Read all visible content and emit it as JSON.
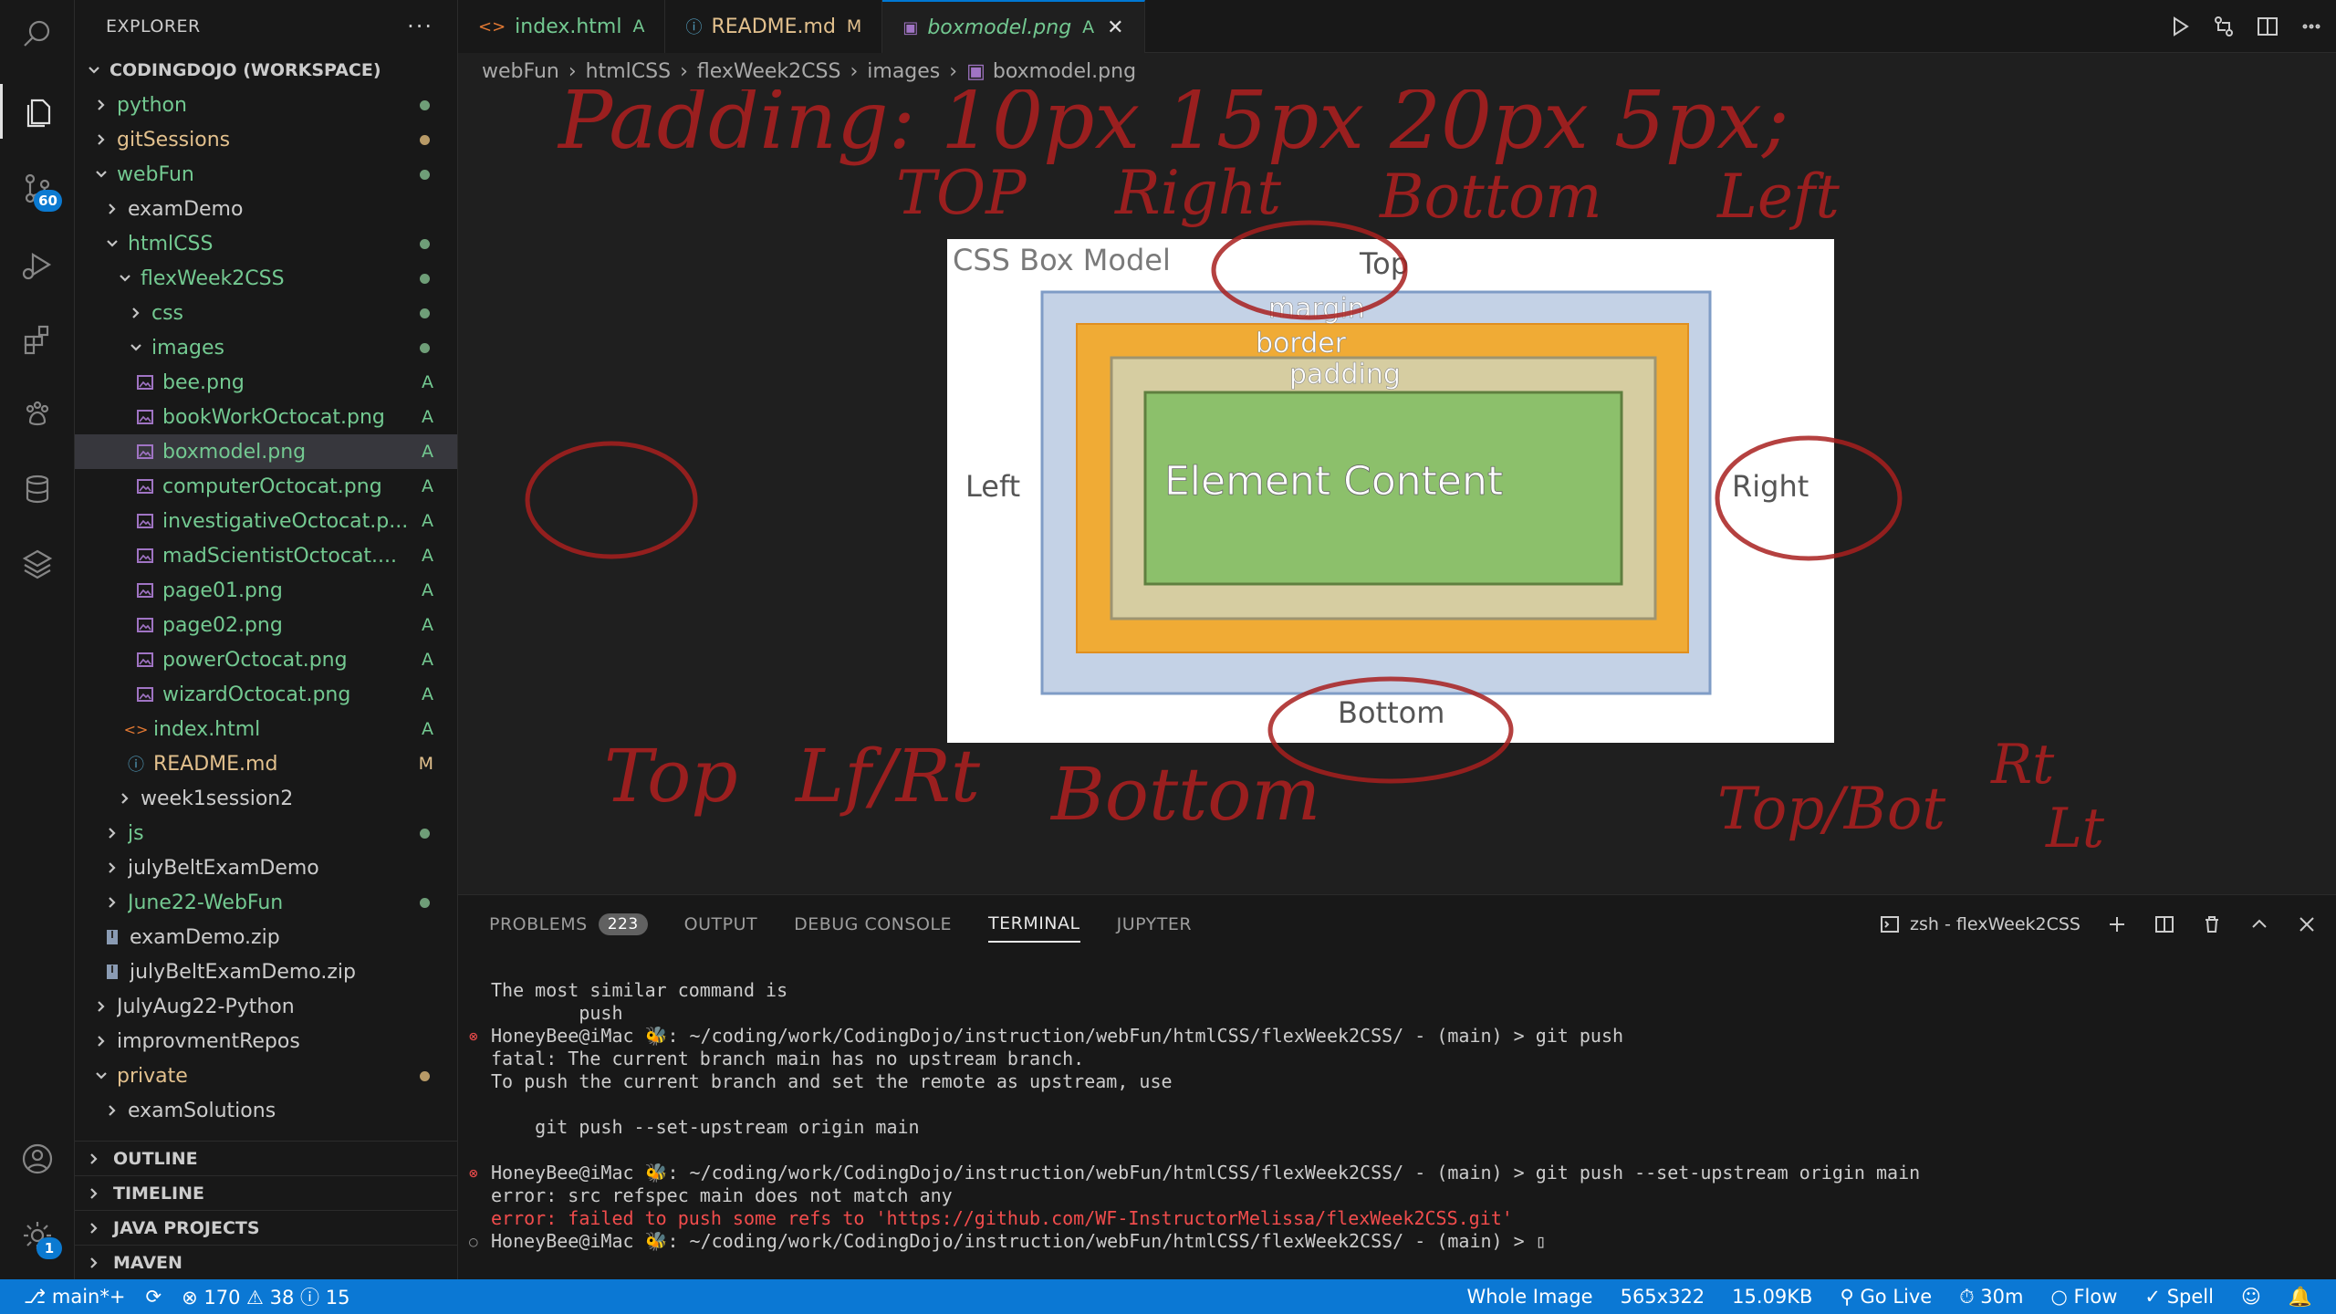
{
  "activity_bar": {
    "scm_badge": "60",
    "settings_badge": "1"
  },
  "sidebar": {
    "title": "EXPLORER",
    "more": "···",
    "workspace": "CODINGDOJO (WORKSPACE)",
    "tree": [
      {
        "label": "python",
        "deco": "",
        "color": "green"
      },
      {
        "label": "gitSessions",
        "deco": "",
        "color": "yellow"
      },
      {
        "label": "webFun",
        "deco": "",
        "color": "green"
      },
      {
        "label": "examDemo",
        "deco": "",
        "color": "plain"
      },
      {
        "label": "htmlCSS",
        "deco": "",
        "color": "green"
      },
      {
        "label": "flexWeek2CSS",
        "deco": "",
        "color": "green"
      },
      {
        "label": "css",
        "deco": "",
        "color": "green"
      },
      {
        "label": "images",
        "deco": "",
        "color": "green"
      },
      {
        "label": "bee.png",
        "deco": "A",
        "color": "green"
      },
      {
        "label": "bookWorkOctocat.png",
        "deco": "A",
        "color": "green"
      },
      {
        "label": "boxmodel.png",
        "deco": "A",
        "color": "green"
      },
      {
        "label": "computerOctocat.png",
        "deco": "A",
        "color": "green"
      },
      {
        "label": "investigativeOctocat.p...",
        "deco": "A",
        "color": "green"
      },
      {
        "label": "madScientistOctocat....",
        "deco": "A",
        "color": "green"
      },
      {
        "label": "page01.png",
        "deco": "A",
        "color": "green"
      },
      {
        "label": "page02.png",
        "deco": "A",
        "color": "green"
      },
      {
        "label": "powerOctocat.png",
        "deco": "A",
        "color": "green"
      },
      {
        "label": "wizardOctocat.png",
        "deco": "A",
        "color": "green"
      },
      {
        "label": "index.html",
        "deco": "A",
        "color": "green"
      },
      {
        "label": "README.md",
        "deco": "M",
        "color": "yellow"
      },
      {
        "label": "week1session2",
        "deco": "",
        "color": "plain"
      },
      {
        "label": "js",
        "deco": "",
        "color": "green"
      },
      {
        "label": "julyBeltExamDemo",
        "deco": "",
        "color": "plain"
      },
      {
        "label": "June22-WebFun",
        "deco": "",
        "color": "green"
      },
      {
        "label": "examDemo.zip",
        "deco": "",
        "color": "plain"
      },
      {
        "label": "julyBeltExamDemo.zip",
        "deco": "",
        "color": "plain"
      },
      {
        "label": "JulyAug22-Python",
        "deco": "",
        "color": "plain"
      },
      {
        "label": "improvmentRepos",
        "deco": "",
        "color": "plain"
      },
      {
        "label": "private",
        "deco": "",
        "color": "yellow"
      },
      {
        "label": "examSolutions",
        "deco": "",
        "color": "plain"
      }
    ],
    "sections": {
      "outline": "OUTLINE",
      "timeline": "TIMELINE",
      "java": "JAVA PROJECTS",
      "maven": "MAVEN"
    }
  },
  "tabs": [
    {
      "label": "index.html",
      "status": "A",
      "icon": "<>"
    },
    {
      "label": "README.md",
      "status": "M",
      "icon": "ⓘ"
    },
    {
      "label": "boxmodel.png",
      "status": "A",
      "icon": "▣"
    }
  ],
  "breadcrumb": [
    "webFun",
    "htmlCSS",
    "flexWeek2CSS",
    "images",
    "boxmodel.png"
  ],
  "image": {
    "title": "CSS Box Model",
    "margin": "margin",
    "border": "border",
    "padding": "padding",
    "content": "Element Content",
    "top": "Top",
    "left": "Left",
    "right": "Right",
    "bottom": "Bottom"
  },
  "annotations": {
    "line1": "Padding: 10px  15px  20px  5px;",
    "line2_top": "TOP",
    "line2_right": "Right",
    "line2_bottom": "Bottom",
    "line2_left": "Left",
    "bottom_1": "Top",
    "bottom_2": "Lf/Rt",
    "bottom_3": "Bottom",
    "bottom_4": "Top/Bot",
    "bottom_5": "Rt",
    "bottom_6": "Lt"
  },
  "panel": {
    "tabs": {
      "problems": "PROBLEMS",
      "problems_count": "223",
      "output": "OUTPUT",
      "debug": "DEBUG CONSOLE",
      "terminal": "TERMINAL",
      "jupyter": "JUPYTER"
    },
    "terminal_name": "zsh - flexWeek2CSS",
    "terminal_lines": [
      {
        "text": "The most similar command is",
        "color": "",
        "mark": ""
      },
      {
        "text": "        push",
        "color": "",
        "mark": ""
      },
      {
        "text": "HoneyBee@iMac 🐝: ~/coding/work/CodingDojo/instruction/webFun/htmlCSS/flexWeek2CSS/ - (main) > git push",
        "color": "",
        "mark": "err"
      },
      {
        "text": "fatal: The current branch main has no upstream branch.",
        "color": "",
        "mark": ""
      },
      {
        "text": "To push the current branch and set the remote as upstream, use",
        "color": "",
        "mark": ""
      },
      {
        "text": "",
        "color": "",
        "mark": ""
      },
      {
        "text": "    git push --set-upstream origin main",
        "color": "",
        "mark": ""
      },
      {
        "text": "",
        "color": "",
        "mark": ""
      },
      {
        "text": "HoneyBee@iMac 🐝: ~/coding/work/CodingDojo/instruction/webFun/htmlCSS/flexWeek2CSS/ - (main) > git push --set-upstream origin main",
        "color": "",
        "mark": "err"
      },
      {
        "text": "error: src refspec main does not match any",
        "color": "",
        "mark": ""
      },
      {
        "text": "error: failed to push some refs to 'https://github.com/WF-InstructorMelissa/flexWeek2CSS.git'",
        "color": "red",
        "mark": ""
      },
      {
        "text": "HoneyBee@iMac 🐝: ~/coding/work/CodingDojo/instruction/webFun/htmlCSS/flexWeek2CSS/ - (main) > ▯",
        "color": "",
        "mark": "idle"
      }
    ]
  },
  "statusbar": {
    "branch": "main*+",
    "errors": "170",
    "warnings": "38",
    "info": "15",
    "whole_image": "Whole Image",
    "dimensions": "565x322",
    "size": "15.09KB",
    "go_live": "Go Live",
    "time": "30m",
    "flow": "Flow",
    "spell": "Spell"
  },
  "colors": {
    "accent": "#0b78d4",
    "ink": "#a8201f",
    "git_added": "#73c991",
    "git_modified": "#e2c08d"
  }
}
